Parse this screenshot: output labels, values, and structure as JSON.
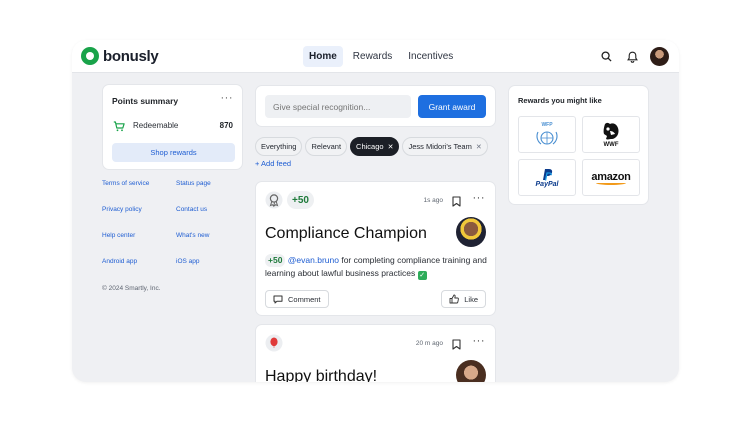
{
  "brand": {
    "name": "bonusly",
    "color": "#19a34a"
  },
  "nav": {
    "items": [
      {
        "label": "Home",
        "active": true
      },
      {
        "label": "Rewards",
        "active": false
      },
      {
        "label": "Incentives",
        "active": false
      }
    ]
  },
  "topbar": {
    "icons": [
      "search-icon",
      "bell-icon",
      "user-avatar"
    ]
  },
  "points": {
    "title": "Points summary",
    "more": "···",
    "redeemable_label": "Redeemable",
    "redeemable_value": "870",
    "shop_label": "Shop rewards"
  },
  "footer": {
    "links": [
      "Terms of service",
      "Status page",
      "Privacy policy",
      "Contact us",
      "Help center",
      "What's new",
      "Android app",
      "iOS app"
    ],
    "copyright": "© 2024 Smartly, Inc."
  },
  "recognition": {
    "placeholder": "Give special recognition...",
    "grant_label": "Grant award",
    "accent": "#1e6fe0"
  },
  "filters": {
    "chips": [
      {
        "label": "Everything",
        "active": false,
        "removable": false
      },
      {
        "label": "Relevant",
        "active": false,
        "removable": false
      },
      {
        "label": "Chicago",
        "active": true,
        "removable": true
      },
      {
        "label": "Jess Midori's Team",
        "active": false,
        "removable": true
      }
    ],
    "add_feed": "+ Add feed"
  },
  "posts": [
    {
      "points": "+50",
      "time": "1s ago",
      "title": "Compliance Champion",
      "body_points": "+50",
      "mention": "@evan.bruno",
      "body": " for completing compliance training and learning about lawful business practices ",
      "comment_label": "Comment",
      "like_label": "Like"
    },
    {
      "time": "20 m ago",
      "title": "Happy birthday!"
    }
  ],
  "rewards": {
    "title": "Rewards you might like",
    "brands": [
      "WFP",
      "WWF",
      "PayPal",
      "amazon"
    ]
  }
}
